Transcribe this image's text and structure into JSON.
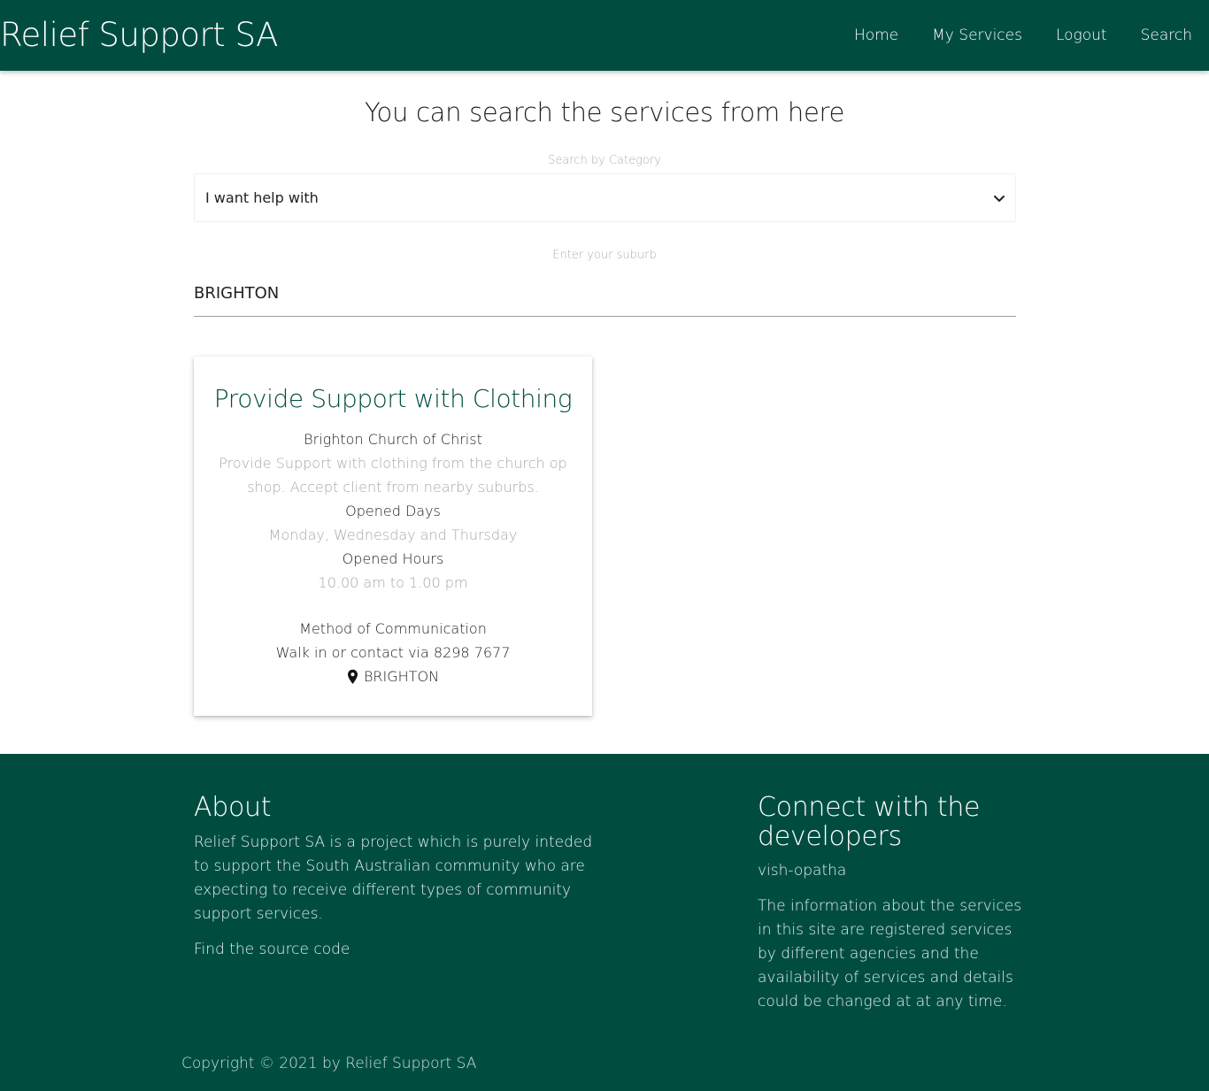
{
  "navbar": {
    "brand": "Relief Support SA",
    "links": [
      "Home",
      "My Services",
      "Logout",
      "Search"
    ]
  },
  "search": {
    "heading": "You can search the services from here",
    "category_label": "Search by Category",
    "category_selected": "I want help with",
    "suburb_label": "Enter your suburb",
    "suburb_value": "BRIGHTON"
  },
  "card": {
    "title": "Provide Support with Clothing",
    "organisation": "Brighton Church of Christ",
    "description": "Provide Support with clothing from the church op shop. Accept client from nearby suburbs.",
    "days_label": "Opened Days",
    "days_value": "Monday, Wednesday and Thursday",
    "hours_label": "Opened Hours",
    "hours_value": "10.00 am to 1.00 pm",
    "comm_label": "Method of Communication",
    "comm_value": "Walk in or contact via 8298 7677",
    "location": "BRIGHTON",
    "location_icon": "map-pin-icon"
  },
  "footer": {
    "about_heading": "About",
    "about_text": "Relief Support SA is a project which is purely inteded to support the South Australian community who are expecting to receive different types of community support services.",
    "source_link": "Find the source code",
    "connect_heading": "Connect with the developers",
    "developer": "vish-opatha",
    "info_text": "The information about the services in this site are registered services by different agencies and the availability of services and details could be changed at at any time.",
    "copyright": "Copyright © 2021 by Relief Support SA"
  },
  "colors": {
    "primary": "#004d40",
    "muted_text": "#a8a8a8"
  }
}
